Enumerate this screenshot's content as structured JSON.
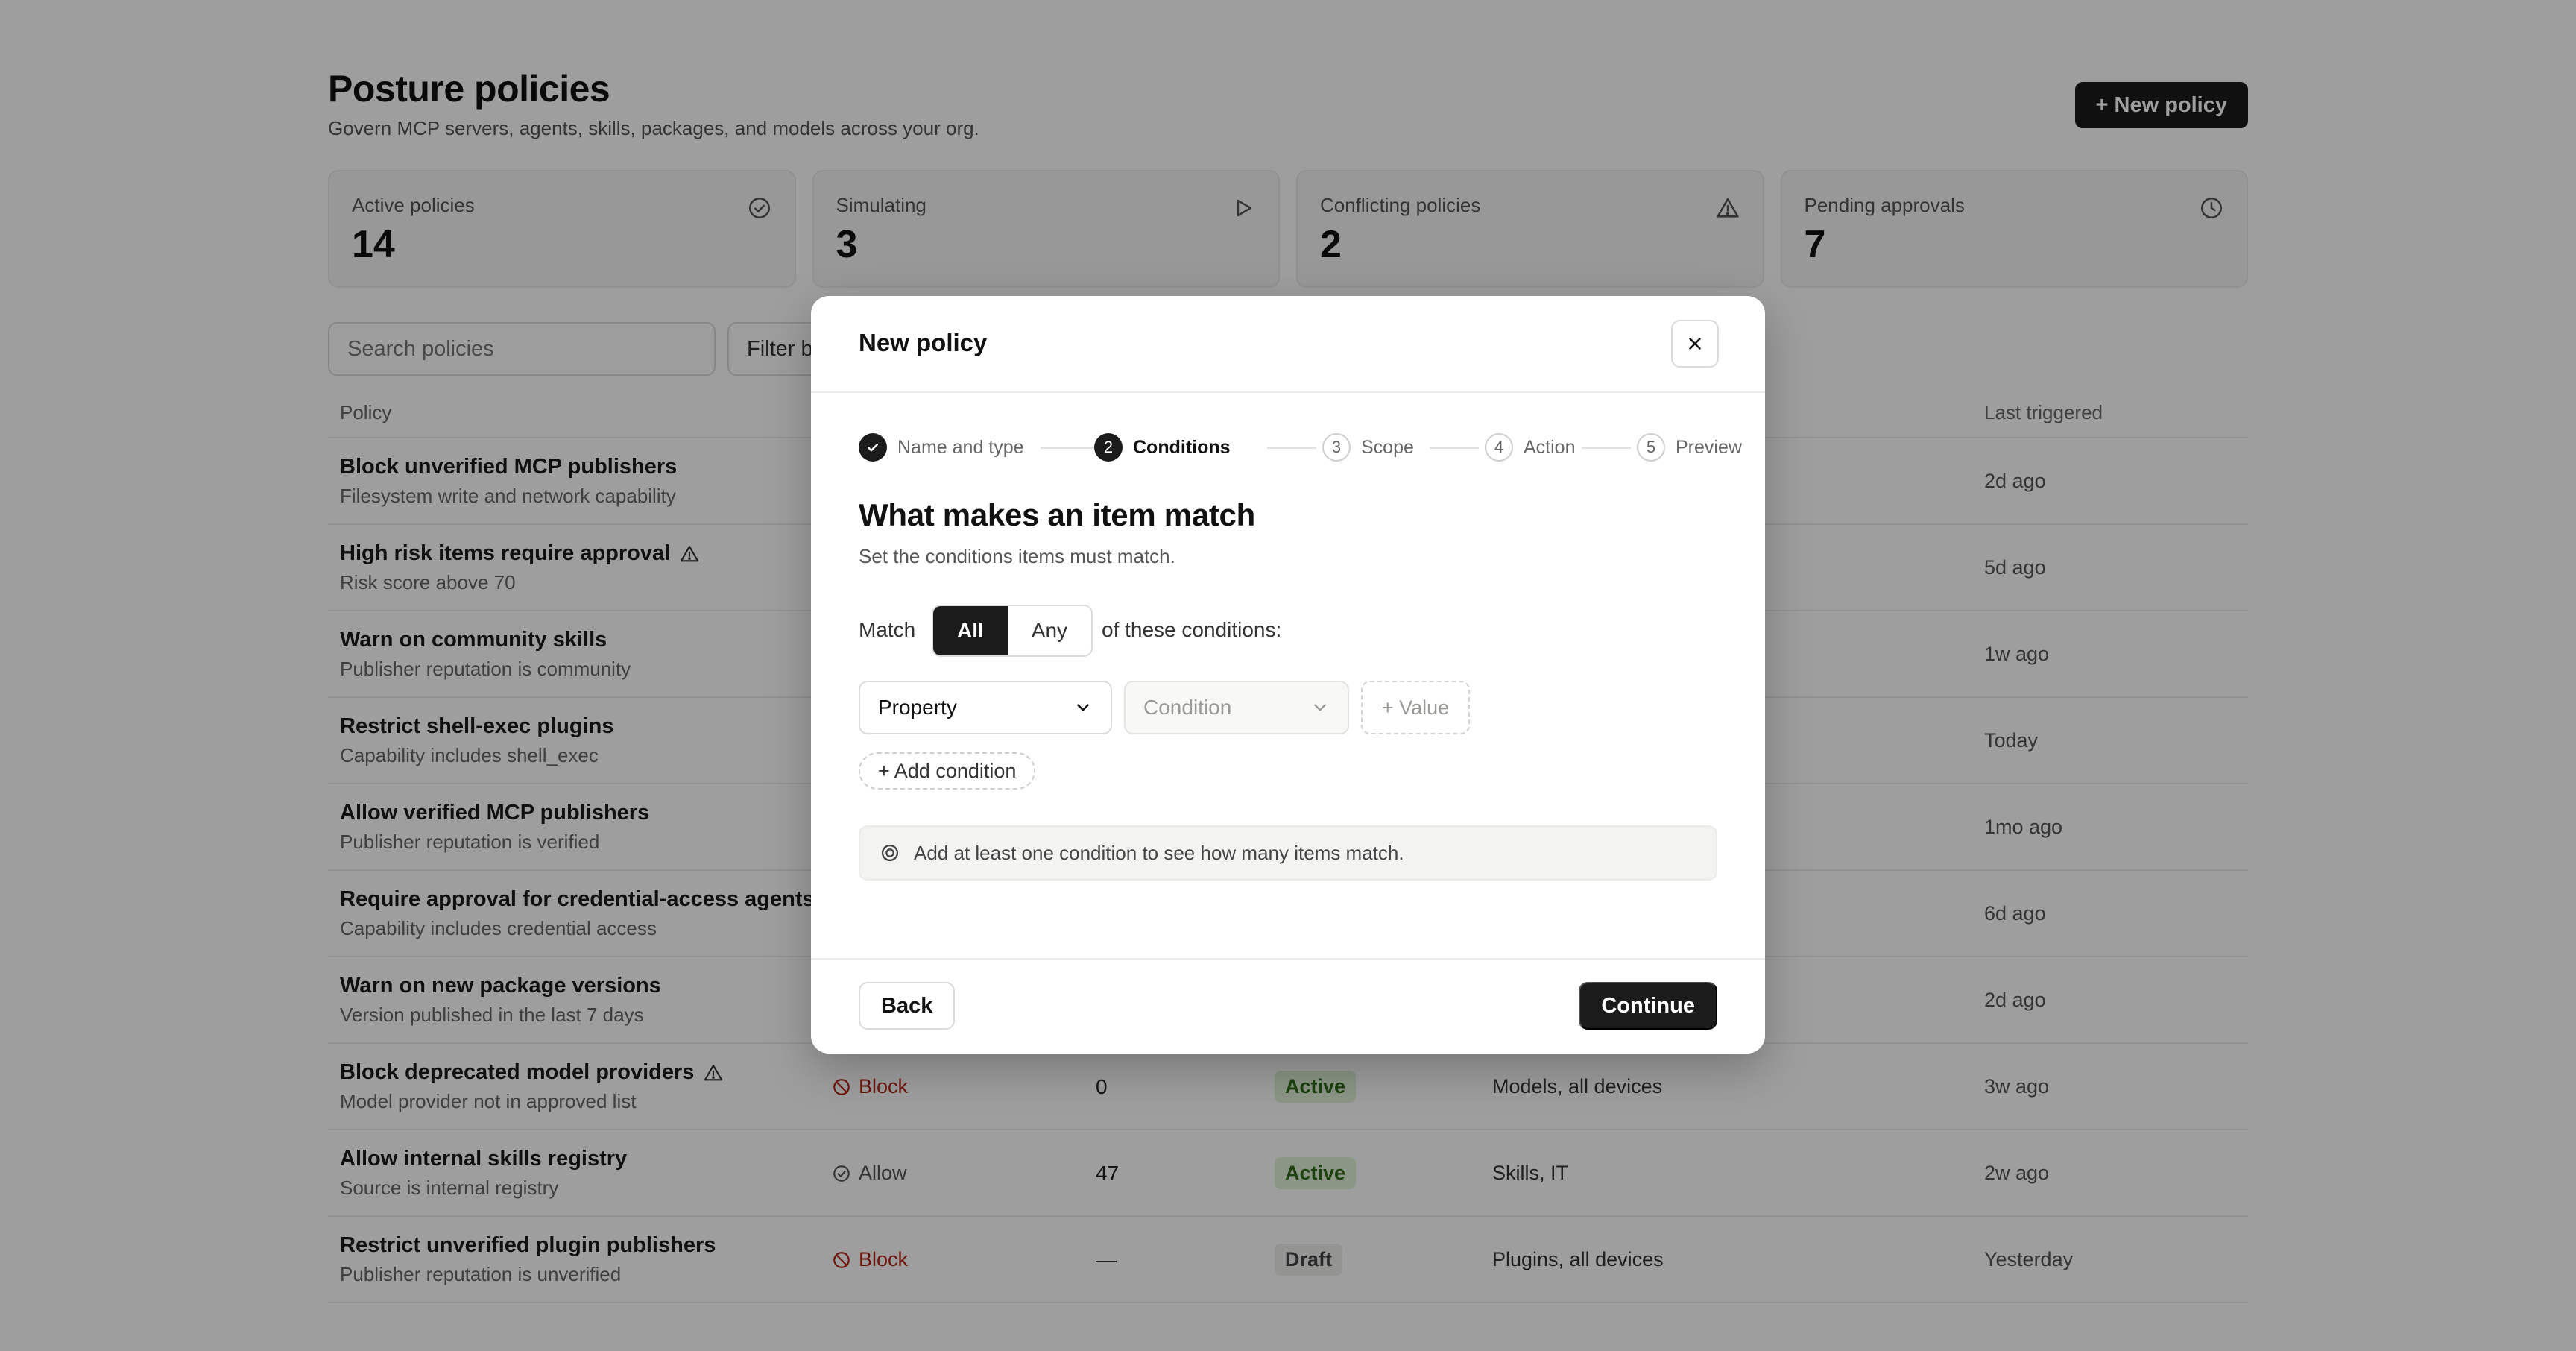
{
  "header": {
    "title": "Posture policies",
    "subtitle": "Govern MCP servers, agents, skills, packages, and models across your org.",
    "new_policy_label": "+ New policy"
  },
  "stats": [
    {
      "label": "Active policies",
      "value": "14",
      "icon": "check-circle-icon"
    },
    {
      "label": "Simulating",
      "value": "3",
      "icon": "play-icon"
    },
    {
      "label": "Conflicting policies",
      "value": "2",
      "icon": "warning-icon"
    },
    {
      "label": "Pending approvals",
      "value": "7",
      "icon": "clock-icon"
    }
  ],
  "toolbar": {
    "search_placeholder": "Search policies",
    "filter_label": "Filter b"
  },
  "table": {
    "columns": {
      "policy": "Policy",
      "last_triggered": "Last triggered"
    },
    "rows": [
      {
        "name": "Block unverified MCP publishers",
        "desc": "Filesystem write and network capability",
        "last": "2d ago"
      },
      {
        "name": "High risk items require approval",
        "desc": "Risk score above 70",
        "last": "5d ago",
        "warning": true
      },
      {
        "name": "Warn on community skills",
        "desc": "Publisher reputation is community",
        "last": "1w ago"
      },
      {
        "name": "Restrict shell-exec plugins",
        "desc": "Capability includes shell_exec",
        "last": "Today"
      },
      {
        "name": "Allow verified MCP publishers",
        "desc": "Publisher reputation is verified",
        "last": "1mo ago"
      },
      {
        "name": "Require approval for credential-access agents",
        "desc": "Capability includes credential access",
        "last": "6d ago"
      },
      {
        "name": "Warn on new package versions",
        "desc": "Version published in the last 7 days",
        "last": "2d ago"
      },
      {
        "name": "Block deprecated model providers",
        "desc": "Model provider not in approved list",
        "action": "Block",
        "action_type": "block",
        "items": "0",
        "status": "Active",
        "status_type": "active",
        "scope": "Models, all devices",
        "last": "3w ago",
        "warning": true
      },
      {
        "name": "Allow internal skills registry",
        "desc": "Source is internal registry",
        "action": "Allow",
        "action_type": "allow",
        "items": "47",
        "status": "Active",
        "status_type": "active",
        "scope": "Skills, IT",
        "last": "2w ago"
      },
      {
        "name": "Restrict unverified plugin publishers",
        "desc": "Publisher reputation is unverified",
        "action": "Block",
        "action_type": "block",
        "items": "—",
        "status": "Draft",
        "status_type": "draft",
        "scope": "Plugins, all devices",
        "last": "Yesterday"
      }
    ]
  },
  "modal": {
    "title": "New policy",
    "steps": [
      {
        "num": "",
        "label": "Name and type",
        "state": "done"
      },
      {
        "num": "2",
        "label": "Conditions",
        "state": "current"
      },
      {
        "num": "3",
        "label": "Scope",
        "state": "todo"
      },
      {
        "num": "4",
        "label": "Action",
        "state": "todo"
      },
      {
        "num": "5",
        "label": "Preview",
        "state": "todo"
      }
    ],
    "section_title": "What makes an item match",
    "section_subtitle": "Set the conditions items must match.",
    "match_label": "Match",
    "match_options": [
      "All",
      "Any"
    ],
    "match_selected": "All",
    "match_suffix": "of these conditions:",
    "property_select": "Property",
    "condition_placeholder": "Condition",
    "value_label": "+ Value",
    "add_condition_label": "+ Add condition",
    "hint": "Add at least one condition to see how many items match.",
    "back_label": "Back",
    "continue_label": "Continue"
  }
}
